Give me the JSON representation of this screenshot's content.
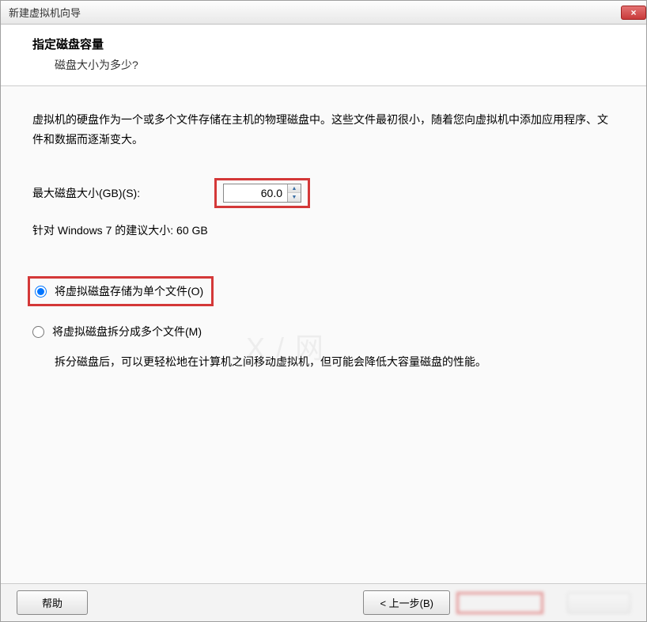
{
  "titlebar": {
    "title": "新建虚拟机向导",
    "close_icon": "×"
  },
  "header": {
    "title": "指定磁盘容量",
    "subtitle": "磁盘大小为多少?"
  },
  "content": {
    "description": "虚拟机的硬盘作为一个或多个文件存储在主机的物理磁盘中。这些文件最初很小，随着您向虚拟机中添加应用程序、文件和数据而逐渐变大。",
    "max_size_label": "最大磁盘大小(GB)(S):",
    "max_size_value": "60.0",
    "recommend_text": "针对 Windows 7 的建议大小: 60 GB",
    "radio1_label": "将虚拟磁盘存储为单个文件(O)",
    "radio1_checked": true,
    "radio2_label": "将虚拟磁盘拆分成多个文件(M)",
    "radio2_checked": false,
    "radio2_desc": "拆分磁盘后，可以更轻松地在计算机之间移动虚拟机，但可能会降低大容量磁盘的性能。"
  },
  "footer": {
    "help_label": "帮助",
    "back_label": "< 上一步(B)"
  }
}
